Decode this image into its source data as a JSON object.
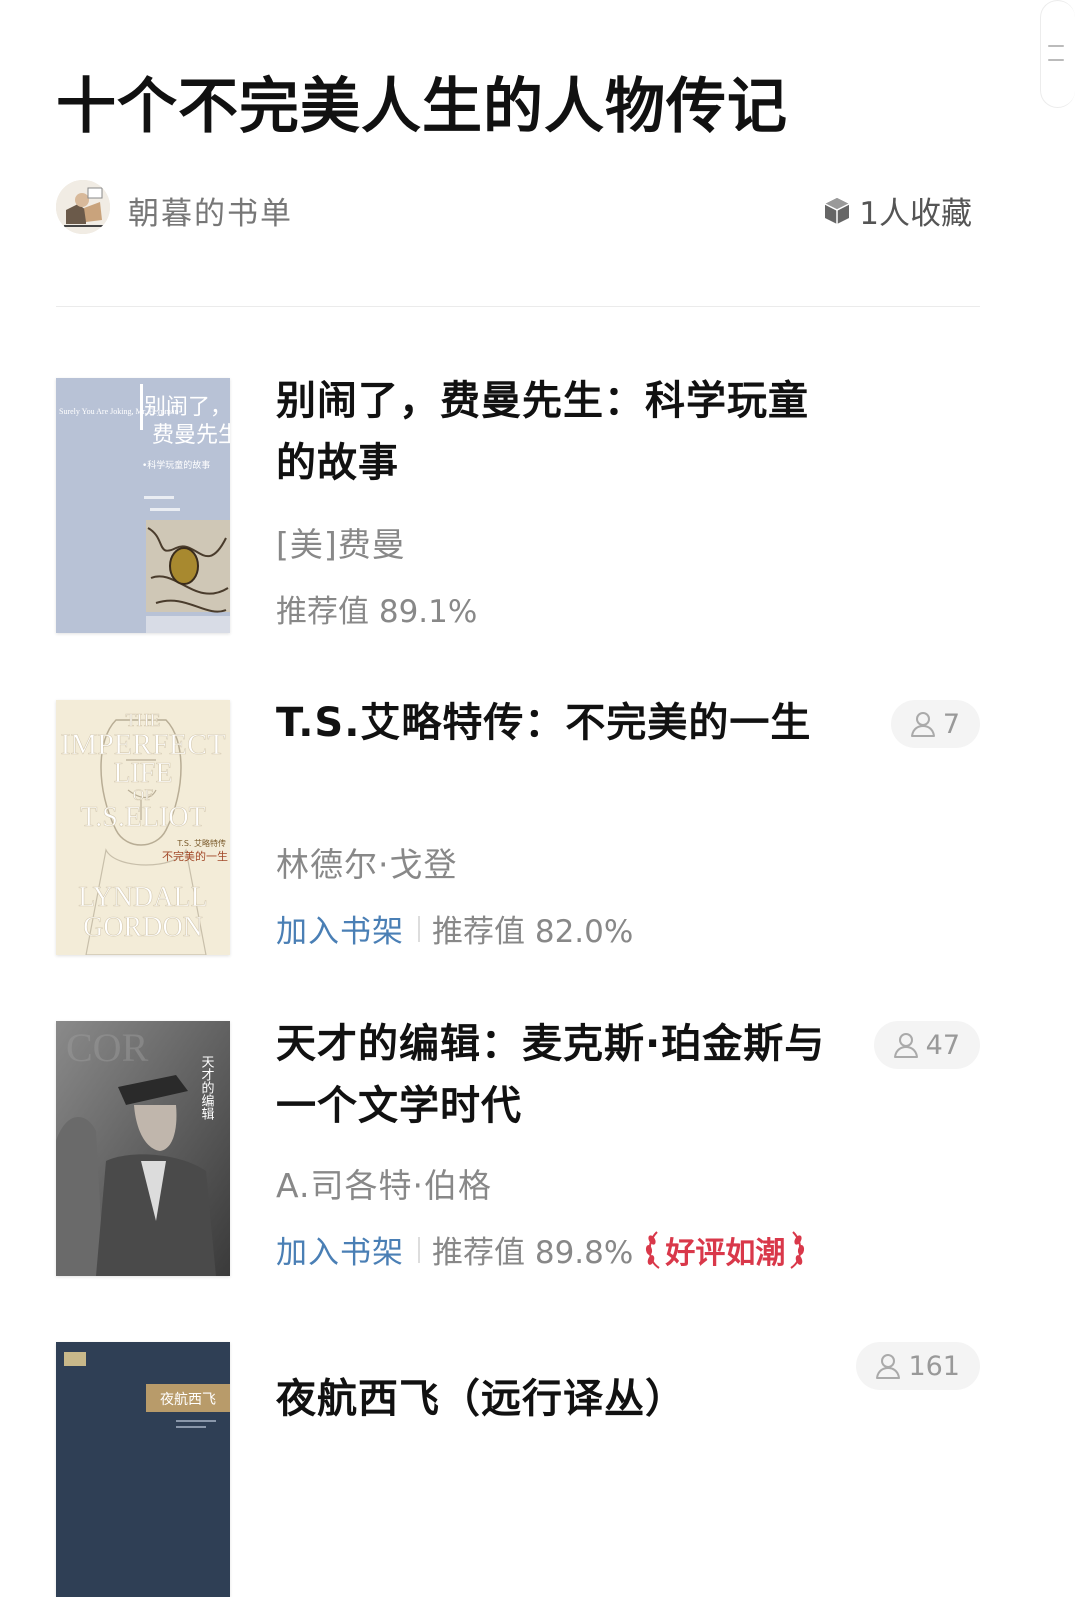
{
  "header": {
    "title": "十个不完美人生的人物传记"
  },
  "meta": {
    "list_owner": "朝暮的书单",
    "favorites": "1人收藏"
  },
  "books": [
    {
      "title": "别闹了，费曼先生：科学玩童的故事",
      "author": "[美]费曼",
      "rating": "推荐值 89.1%",
      "cover": {
        "en_title": "Surely You Are Joking, Mr. Feynman",
        "cn_title_1": "别闹了，",
        "cn_title_2": "费曼先生",
        "subtitle": "•科学玩童的故事"
      }
    },
    {
      "title": "T.S.艾略特传：不完美的一生",
      "author": "林德尔·戈登",
      "shelf": "加入书架",
      "rating": "推荐值 82.0%",
      "readers": "7",
      "cover": {
        "en_1": "THE",
        "en_2": "IMPERFECT",
        "en_3": "LIFE",
        "en_4": "OF",
        "en_5": "T.S.ELIOT",
        "cn_1": "T.S. 艾略特传",
        "cn_2": "不完美的一生",
        "auth_1": "LYNDALL",
        "auth_2": "GORDON"
      }
    },
    {
      "title": "天才的编辑：麦克斯·珀金斯与一个文学时代",
      "author": "A.司各特·伯格",
      "shelf": "加入书架",
      "rating": "推荐值 89.8%",
      "readers": "47",
      "badge": "好评如潮",
      "cover": {
        "cn_title": "天才的编辑"
      }
    },
    {
      "title": "夜航西飞（远行译丛）",
      "readers": "161",
      "cover": {
        "cn_title": "夜航西飞"
      }
    }
  ]
}
